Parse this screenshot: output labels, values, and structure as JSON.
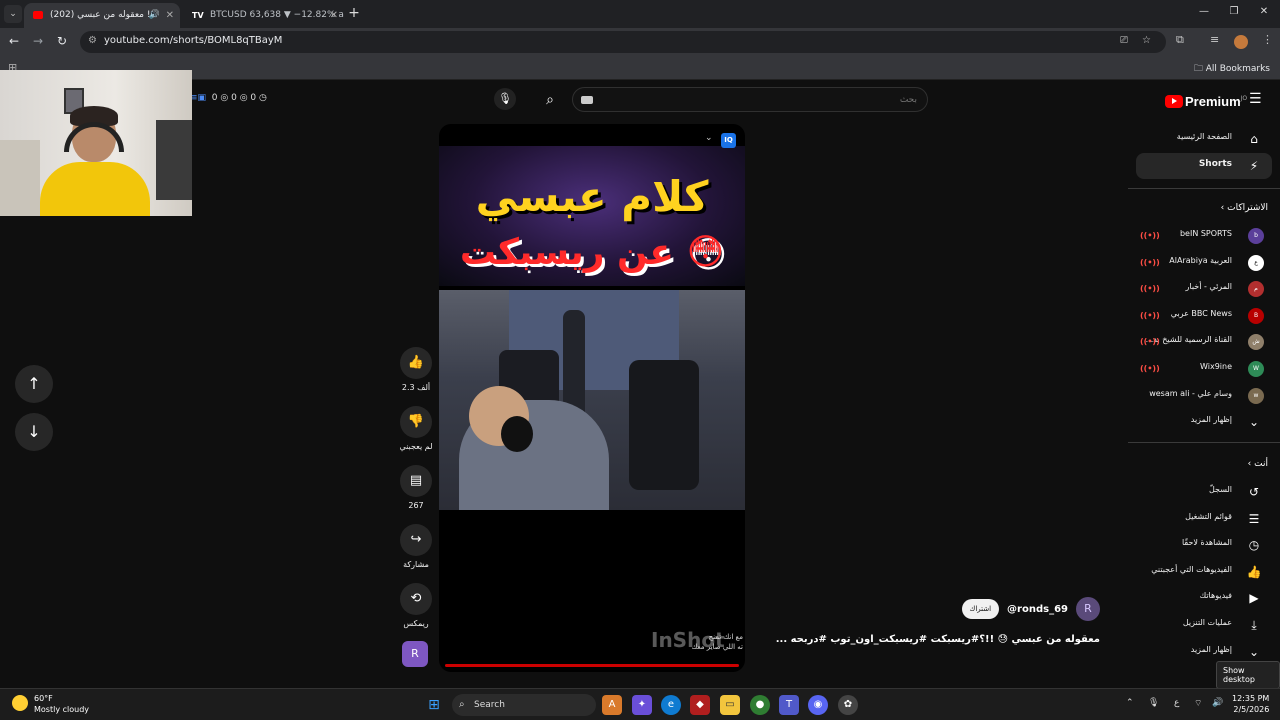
{
  "browser": {
    "tabs": [
      {
        "title": "(202) معقوله من عبسي !!",
        "active": true
      },
      {
        "title": "BTCUSD 63,638 ▼ −12.82% ab",
        "active": false
      }
    ],
    "url": "youtube.com/shorts/BOML8qTBayM",
    "all_bookmarks": "All Bookmarks"
  },
  "yt": {
    "logo_text": "Premium",
    "logo_sup": "JO",
    "search_placeholder": "بحث",
    "ext_counts": [
      "0",
      "0",
      "0"
    ]
  },
  "actions": {
    "like_count": "2.3 ألف",
    "dislike_label": "لم يعجبني",
    "comment_count": "267",
    "share_label": "مشاركة",
    "remix_label": "ريمكس"
  },
  "video": {
    "thumb_line1": "كلام عبسي",
    "thumb_line2": "عن ريسبكت 😳",
    "watermark": "InShot",
    "caption_line1": "مع انك تمنح",
    "caption_line2": "ته اللي صاير معك"
  },
  "channel": {
    "handle": "@ronds_69",
    "subscribe_label": "اشتراك",
    "video_title": "معقوله من عبسي 😓 !!؟#ريسبكت #ريسبكت_اون_توب #دربحه ..."
  },
  "sidebar": {
    "home": "الصفحة الرئيسية",
    "shorts": "Shorts",
    "subscriptions_header": "الاشتراكات",
    "subscriptions": [
      {
        "name": "beIN SPORTS",
        "color": "#5b3f9a",
        "live": true
      },
      {
        "name": "العربية AlArabiya",
        "color": "#ffffff",
        "live": true
      },
      {
        "name": "المرئي - أخبار",
        "color": "#b22f2f",
        "live": true
      },
      {
        "name": "BBC News عربي",
        "color": "#b80000",
        "live": true
      },
      {
        "name": "القناة الرسمية للشيخ بد...",
        "color": "#8f7f6a",
        "live": true
      },
      {
        "name": "Wix9ine",
        "color": "#2e8b57",
        "live": true
      },
      {
        "name": "وسام علي - wesam ali",
        "color": "#7a6a50",
        "live": false
      }
    ],
    "show_more_subs": "إظهار المزيد",
    "you_header": "أنت",
    "you_items": [
      {
        "label": "السجلّ",
        "icon": "history-icon"
      },
      {
        "label": "قوائم التشغيل",
        "icon": "playlist-icon"
      },
      {
        "label": "المشاهدة لاحقًا",
        "icon": "clock-icon"
      },
      {
        "label": "الفيديوهات التي أعجبتني",
        "icon": "thumbs-up-icon"
      },
      {
        "label": "فيديوهاتك",
        "icon": "your-videos-icon"
      },
      {
        "label": "عمليات التنزيل",
        "icon": "download-icon"
      },
      {
        "label": "إظهار المزيد",
        "icon": "chevron-down-icon"
      }
    ]
  },
  "tooltip": "Show desktop",
  "taskbar": {
    "temp": "60°F",
    "weather": "Mostly cloudy",
    "search": "Search",
    "time": "12:35 PM",
    "date": "2/5/2026",
    "lang": "ع"
  }
}
